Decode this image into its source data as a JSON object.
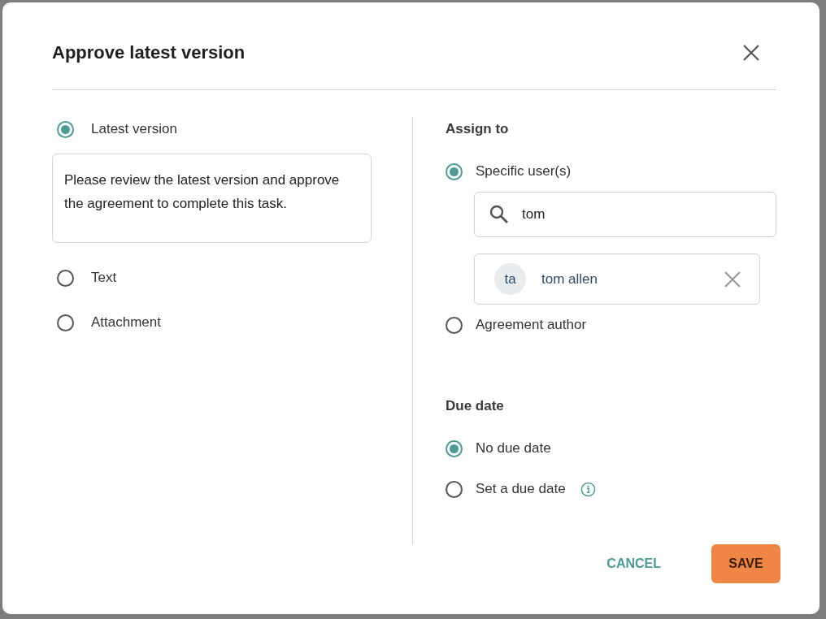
{
  "dialog": {
    "title": "Approve latest version"
  },
  "content_options": [
    {
      "label": "Latest version",
      "selected": true,
      "message": "Please review the latest version and approve the agreement to complete this task."
    },
    {
      "label": "Text",
      "selected": false
    },
    {
      "label": "Attachment",
      "selected": false
    }
  ],
  "assign_to": {
    "heading": "Assign to",
    "options": [
      {
        "label": "Specific user(s)",
        "selected": true,
        "search": {
          "value": "tom"
        },
        "users": [
          {
            "initials": "ta",
            "name": "tom allen"
          }
        ]
      },
      {
        "label": "Agreement author",
        "selected": false
      }
    ]
  },
  "due_date": {
    "heading": "Due date",
    "options": [
      {
        "label": "No due date",
        "selected": true,
        "info": false
      },
      {
        "label": "Set a due date",
        "selected": false,
        "info": true
      }
    ]
  },
  "buttons": [
    {
      "label": "CANCEL",
      "kind": "text"
    },
    {
      "label": "SAVE",
      "kind": "primary"
    }
  ]
}
